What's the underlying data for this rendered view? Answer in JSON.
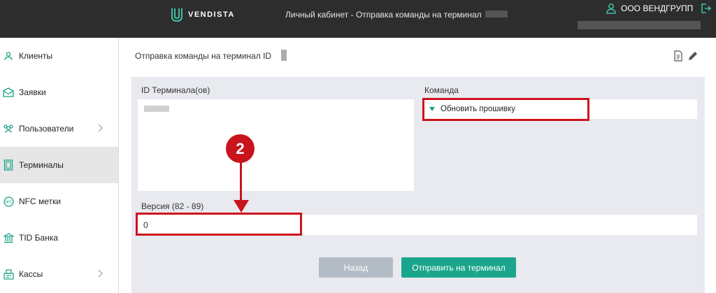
{
  "header": {
    "logo_text": "VENDISTA",
    "title": "Личный кабинет - Отправка команды на терминал",
    "org_name": "ООО ВЕНДГРУПП"
  },
  "sidebar": {
    "items": [
      {
        "label": "Клиенты",
        "icon": "clients-icon",
        "active": false,
        "has_chevron": false
      },
      {
        "label": "Заявки",
        "icon": "envelope-icon",
        "active": false,
        "has_chevron": false
      },
      {
        "label": "Пользователи",
        "icon": "users-icon",
        "active": false,
        "has_chevron": true
      },
      {
        "label": "Терминалы",
        "icon": "terminal-icon",
        "active": true,
        "has_chevron": false
      },
      {
        "label": "NFC метки",
        "icon": "nfc-icon",
        "active": false,
        "has_chevron": false
      },
      {
        "label": "TID Банка",
        "icon": "bank-icon",
        "active": false,
        "has_chevron": false
      },
      {
        "label": "Кассы",
        "icon": "cashbox-icon",
        "active": false,
        "has_chevron": true
      }
    ]
  },
  "main": {
    "page_title": "Отправка команды на терминал ID",
    "terminal_ids_label": "ID Терминала(ов)",
    "command_label": "Команда",
    "command_value": "Обновить прошивку",
    "version_label": "Версия (82 - 89)",
    "version_value": "0",
    "back_button": "Назад",
    "send_button": "Отправить на терминал"
  },
  "annotation": {
    "step_number": "2",
    "color": "#c8141c"
  },
  "colors": {
    "header_bg": "#2d2d2d",
    "accent": "#1aa68c",
    "panel_bg": "#e8eaf0",
    "disabled_button": "#b3bcc5"
  }
}
